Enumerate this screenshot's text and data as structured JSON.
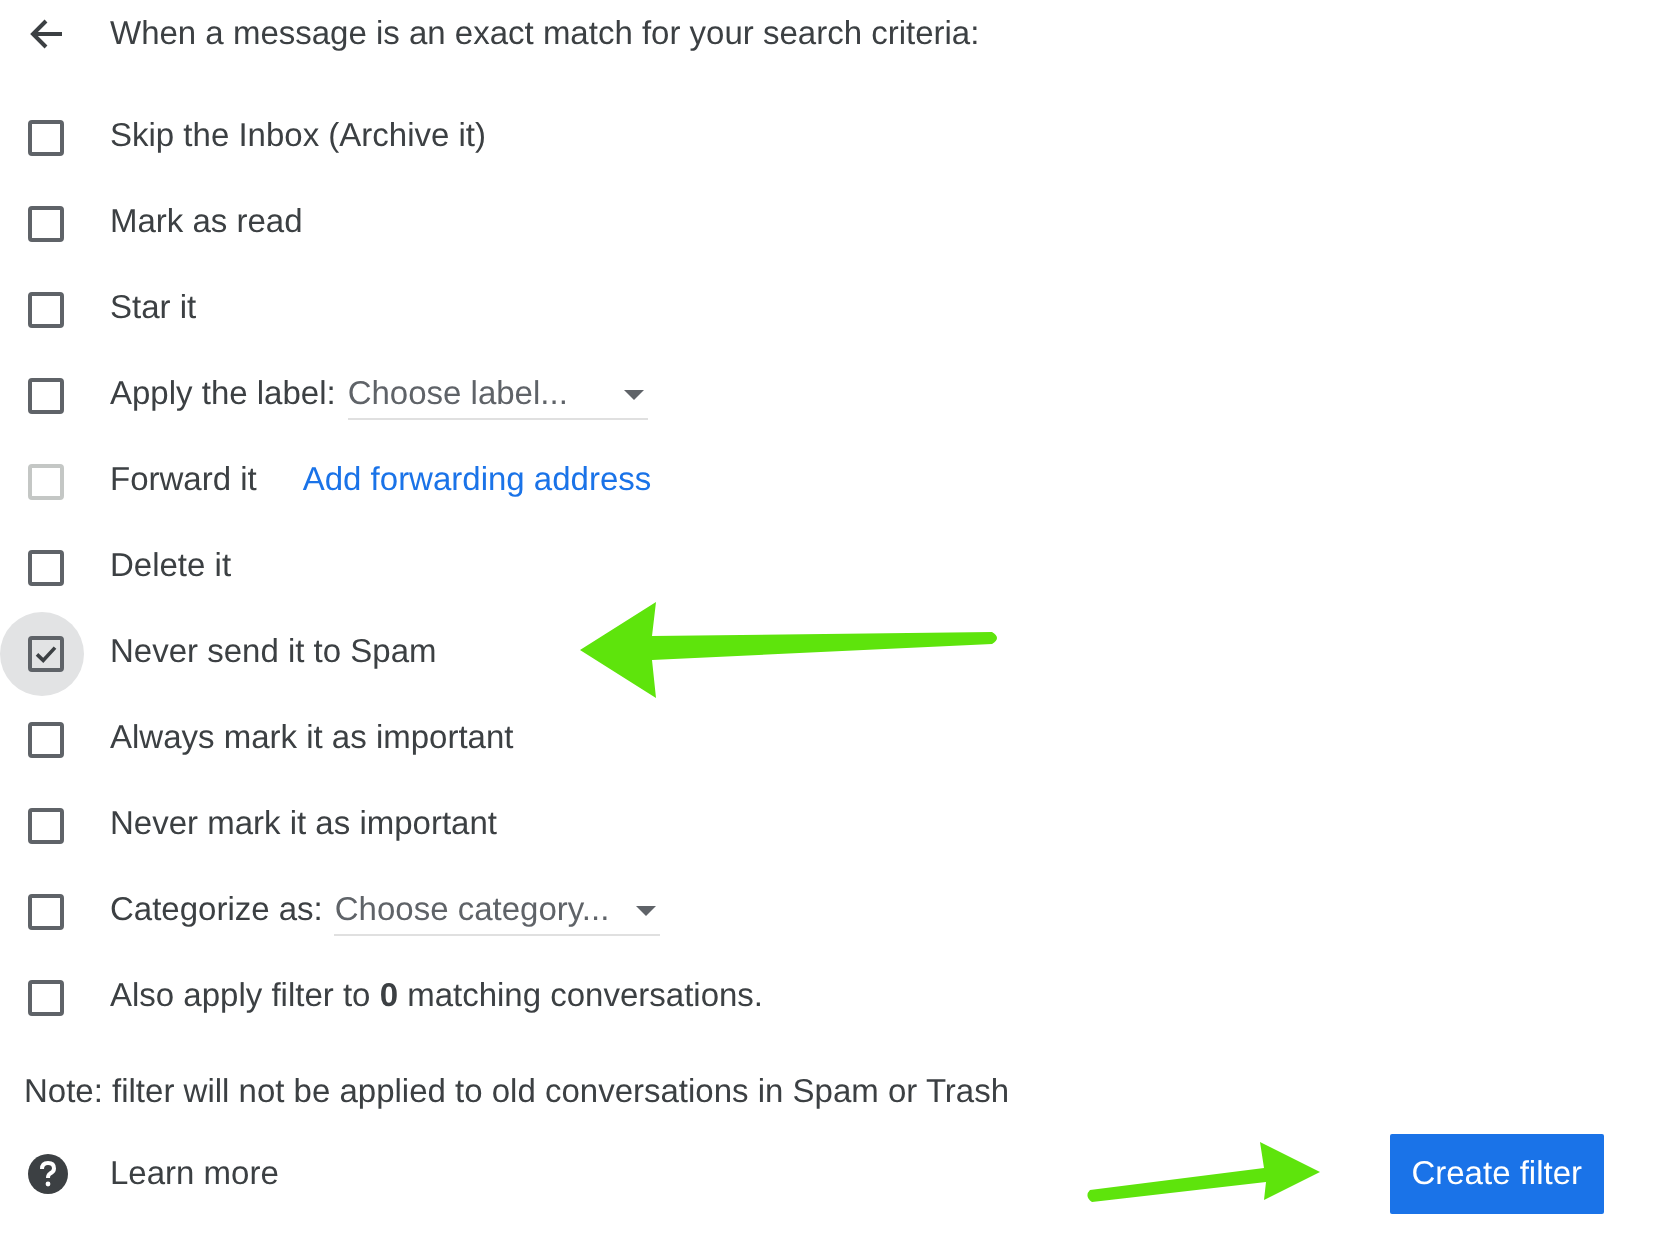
{
  "header": {
    "title": "When a message is an exact match for your search criteria:"
  },
  "actions": [
    {
      "kind": "plain",
      "label": "Skip the Inbox (Archive it)",
      "checked": false,
      "disabled": false,
      "focused": false,
      "arrow": false
    },
    {
      "kind": "plain",
      "label": "Mark as read",
      "checked": false,
      "disabled": false,
      "focused": false,
      "arrow": false
    },
    {
      "kind": "plain",
      "label": "Star it",
      "checked": false,
      "disabled": false,
      "focused": false,
      "arrow": false
    },
    {
      "kind": "dropdown",
      "label": "Apply the label:",
      "placeholder": "Choose label...",
      "checked": false,
      "disabled": false,
      "focused": false,
      "arrow": false
    },
    {
      "kind": "link",
      "label": "Forward it",
      "link": "Add forwarding address",
      "checked": false,
      "disabled": true,
      "focused": false,
      "arrow": false
    },
    {
      "kind": "plain",
      "label": "Delete it",
      "checked": false,
      "disabled": false,
      "focused": false,
      "arrow": false
    },
    {
      "kind": "plain",
      "label": "Never send it to Spam",
      "checked": true,
      "disabled": false,
      "focused": true,
      "arrow": true
    },
    {
      "kind": "plain",
      "label": "Always mark it as important",
      "checked": false,
      "disabled": false,
      "focused": false,
      "arrow": false
    },
    {
      "kind": "plain",
      "label": "Never mark it as important",
      "checked": false,
      "disabled": false,
      "focused": false,
      "arrow": false
    },
    {
      "kind": "dropdown",
      "label": "Categorize as:",
      "placeholder": "Choose category...",
      "checked": false,
      "disabled": false,
      "focused": false,
      "arrow": false
    },
    {
      "kind": "plain",
      "label": "Also apply filter to **0** matching conversations.",
      "checked": false,
      "disabled": false,
      "focused": false,
      "arrow": false
    }
  ],
  "note": "Note: filter will not be applied to old conversations in Spam or Trash",
  "learn_more": "Learn more",
  "create_button": {
    "label": "Create filter",
    "arrow": true
  }
}
